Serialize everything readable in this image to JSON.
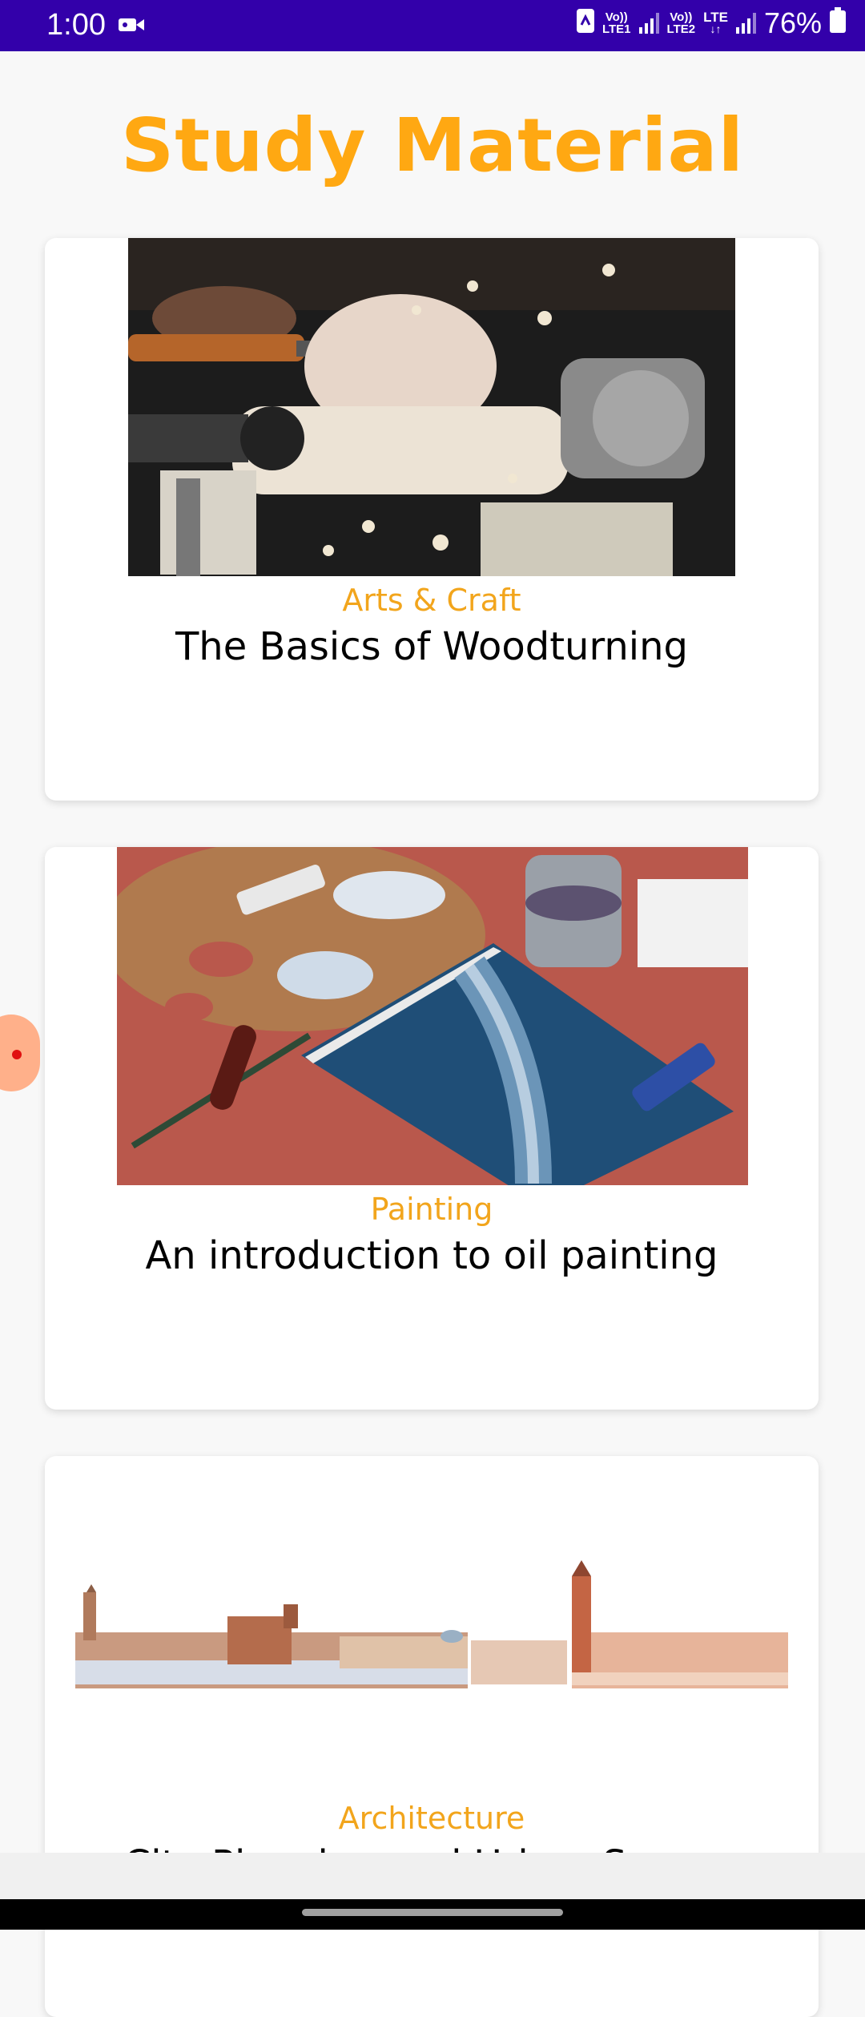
{
  "status_bar": {
    "time": "1:00",
    "sim1_label_top": "Vo))",
    "sim1_label_bottom": "LTE1",
    "sim2_label_top": "Vo))",
    "sim2_label_bottom": "LTE2",
    "data_label": "LTE",
    "battery": "76%"
  },
  "page": {
    "title": "Study Material"
  },
  "cards": [
    {
      "category": "Arts & Craft",
      "title": "The Basics of Woodturning"
    },
    {
      "category": "Painting",
      "title": "An introduction to oil painting"
    },
    {
      "category": "Architecture",
      "title": "City Planning and Urban Spaces"
    }
  ],
  "colors": {
    "accent": "#ffa812",
    "status_bar": "#3300aa",
    "category": "#f2a51c"
  }
}
